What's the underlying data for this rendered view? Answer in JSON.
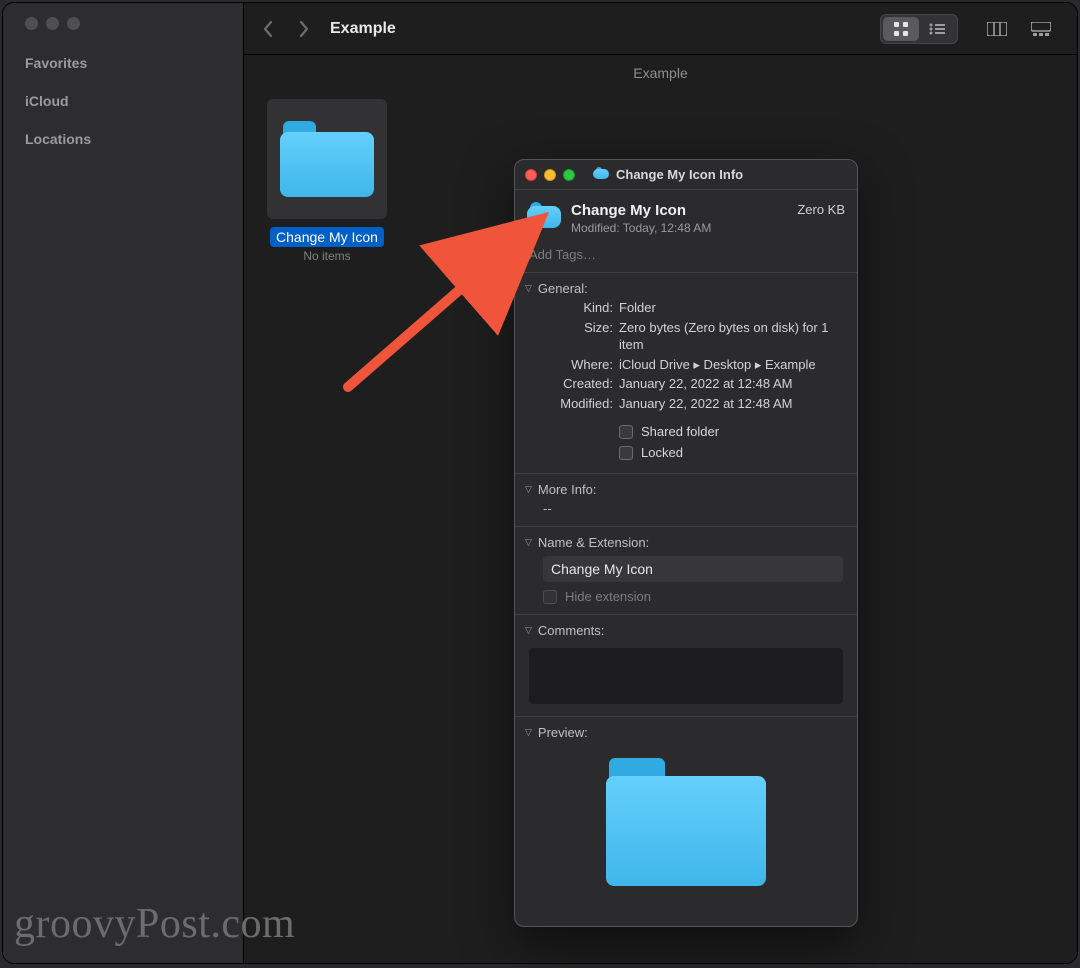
{
  "sidebar": {
    "sections": [
      "Favorites",
      "iCloud",
      "Locations"
    ]
  },
  "toolbar": {
    "title": "Example",
    "crumb": "Example"
  },
  "item": {
    "name": "Change My Icon",
    "sub": "No items"
  },
  "info": {
    "wintitle": "Change My Icon Info",
    "name": "Change My Icon",
    "modified_short": "Modified: Today, 12:48 AM",
    "size_str": "Zero KB",
    "tags_placeholder": "Add Tags…",
    "general": {
      "head": "General:",
      "kind_k": "Kind:",
      "kind_v": "Folder",
      "size_k": "Size:",
      "size_v": "Zero bytes (Zero bytes on disk) for 1 item",
      "where_k": "Where:",
      "where_v": "iCloud Drive ▸ Desktop ▸ Example",
      "created_k": "Created:",
      "created_v": "January 22, 2022 at 12:48 AM",
      "mod_k": "Modified:",
      "mod_v": "January 22, 2022 at 12:48 AM",
      "shared": "Shared folder",
      "locked": "Locked"
    },
    "moreinfo": {
      "head": "More Info:",
      "val": "--"
    },
    "nameext": {
      "head": "Name & Extension:",
      "value": "Change My Icon",
      "hide": "Hide extension"
    },
    "comments": {
      "head": "Comments:"
    },
    "preview": {
      "head": "Preview:"
    }
  },
  "watermark": "groovyPost.com"
}
